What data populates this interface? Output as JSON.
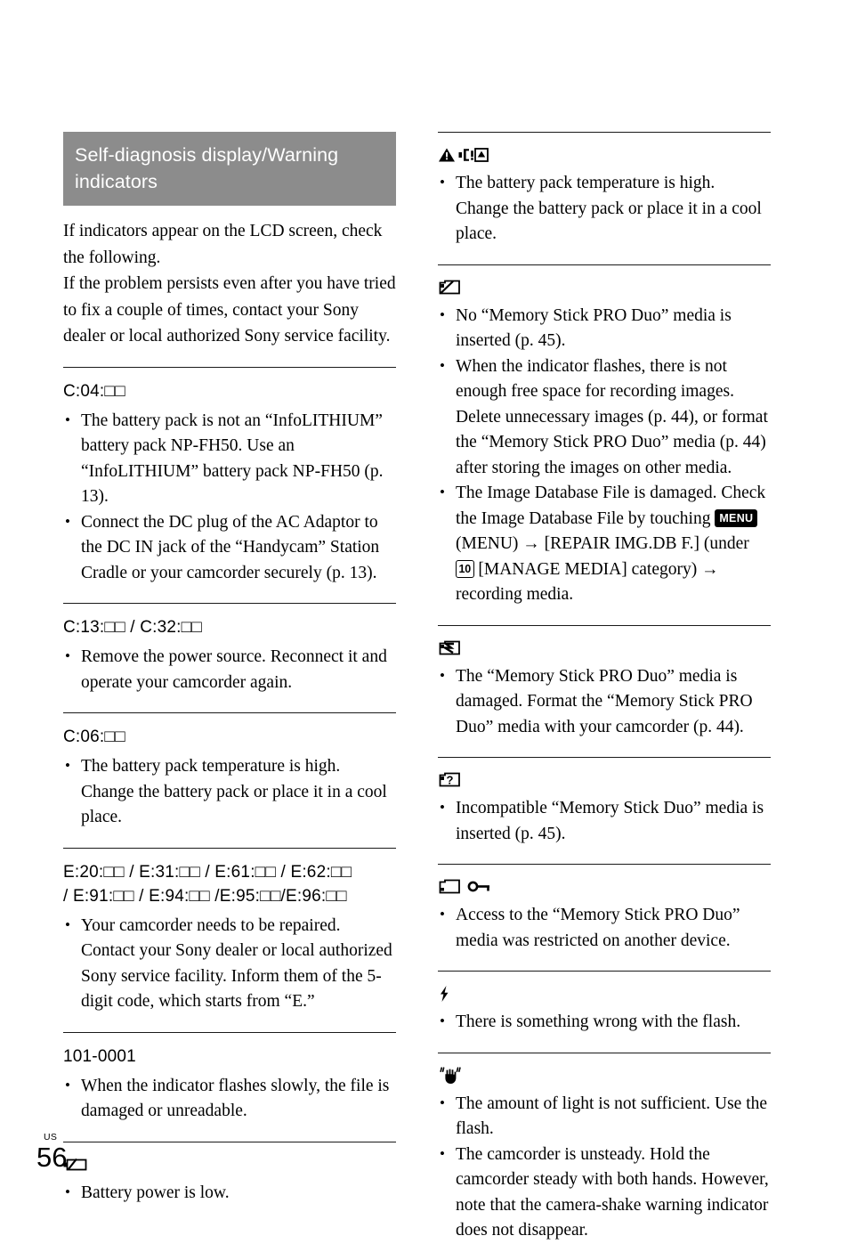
{
  "section": {
    "title": "Self-diagnosis display/Warning indicators",
    "band_color": "#8c8c8c"
  },
  "intro": {
    "line1": "If indicators appear on the LCD screen, check the following.",
    "line2": "If the problem persists even after you have tried to fix a couple of times, contact your Sony dealer or local authorized Sony service facility."
  },
  "left_column": {
    "entries": [
      {
        "heading_type": "code",
        "heading_parts": [
          "C:04:",
          "box",
          "box"
        ],
        "heading_text": "C:04:□□",
        "bullets": [
          "The battery pack is not an “InfoLITHIUM” battery pack NP-FH50. Use an “InfoLITHIUM” battery pack NP-FH50 (p. 13).",
          "Connect the DC plug of the AC Adaptor to the DC IN jack of the “Handycam” Station Cradle or your camcorder securely (p. 13)."
        ]
      },
      {
        "heading_type": "code",
        "heading_text": "C:13:□□ / C:32:□□",
        "bullets": [
          "Remove the power source. Reconnect it and operate your camcorder again."
        ]
      },
      {
        "heading_type": "code",
        "heading_text": "C:06:□□",
        "bullets": [
          "The battery pack temperature is high. Change the battery pack or place it in a cool place."
        ]
      },
      {
        "heading_type": "code",
        "heading_line1": "E:20:□□ / E:31:□□ / E:61:□□ / E:62:□□",
        "heading_line2": "/ E:91:□□ / E:94:□□ /E:95:□□/E:96:□□",
        "bullets": [
          "Your camcorder needs to be repaired. Contact your Sony dealer or local authorized Sony service facility. Inform them of the 5-digit code, which starts from “E.”"
        ]
      },
      {
        "heading_type": "plain",
        "heading_text": "101-0001",
        "bullets": [
          "When the indicator flashes slowly, the file is damaged or unreadable."
        ]
      },
      {
        "heading_type": "icon",
        "icon": "battery-low-icon",
        "bullets": [
          "Battery power is low."
        ]
      }
    ]
  },
  "right_column": {
    "entries": [
      {
        "heading_type": "icon",
        "icons": [
          "warning-triangle-icon",
          "battery-temperature-icon"
        ],
        "bullets": [
          "The battery pack temperature is high. Change the battery pack or place it in a cool place."
        ]
      },
      {
        "heading_type": "icon",
        "icons": [
          "no-memory-stick-icon"
        ],
        "bullets": [
          "No “Memory Stick PRO Duo” media is inserted (p. 45).",
          "When the indicator flashes, there is not enough free space for recording images. Delete unnecessary images (p. 44), or format the “Memory Stick PRO Duo” media (p. 44) after storing the images on other media.",
          "IMAGE_DB_BULLET"
        ],
        "image_db_bullet": {
          "part1": "The Image Database File is damaged. Check the Image Database File by touching ",
          "menu_badge": "MENU",
          "part2": " (MENU) → [REPAIR IMG.DB F.] (under ",
          "num_badge": "10",
          "part3": " [MANAGE MEDIA] category) → recording media."
        }
      },
      {
        "heading_type": "icon",
        "icons": [
          "damaged-memory-stick-icon"
        ],
        "bullets": [
          "The “Memory Stick PRO Duo” media is damaged. Format the “Memory Stick PRO Duo” media with your camcorder (p. 44)."
        ]
      },
      {
        "heading_type": "icon",
        "icons": [
          "incompatible-memory-stick-icon"
        ],
        "bullets": [
          "Incompatible “Memory Stick Duo” media is inserted (p. 45)."
        ]
      },
      {
        "heading_type": "icon",
        "icons": [
          "memory-stick-icon",
          "key-lock-icon"
        ],
        "bullets": [
          "Access to the “Memory Stick PRO Duo” media was restricted on another device."
        ]
      },
      {
        "heading_type": "icon",
        "icons": [
          "flash-icon"
        ],
        "bullets": [
          "There is something wrong with the flash."
        ]
      },
      {
        "heading_type": "icon",
        "icons": [
          "camera-shake-hand-icon"
        ],
        "bullets": [
          "The amount of light is not sufficient. Use the flash.",
          "The camcorder is unsteady. Hold the camcorder steady with both hands. However, note that the camera-shake warning indicator does not disappear."
        ]
      }
    ]
  },
  "footer": {
    "region": "US",
    "page_number": "56"
  }
}
